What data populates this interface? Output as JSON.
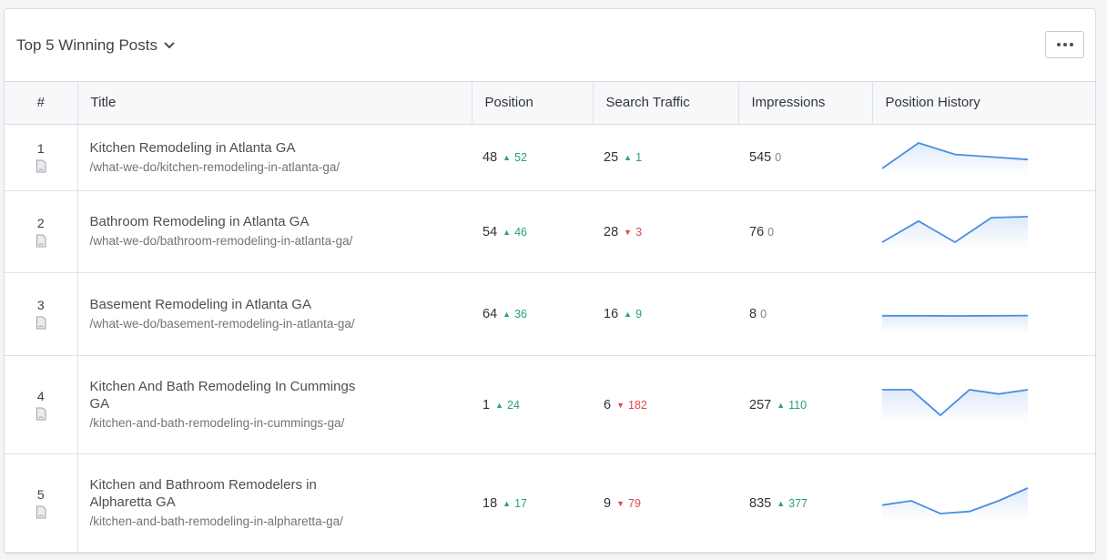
{
  "widget": {
    "title": "Top 5 Winning Posts"
  },
  "columns": {
    "num": "#",
    "title": "Title",
    "position": "Position",
    "traffic": "Search Traffic",
    "impressions": "Impressions",
    "history": "Position History"
  },
  "colors": {
    "accent": "#4a8ee0",
    "up": "#28a17a",
    "down": "#e0474c"
  },
  "rows": [
    {
      "rank": "1",
      "title": "Kitchen Remodeling in Atlanta GA",
      "url": "/what-we-do/kitchen-remodeling-in-atlanta-ga/",
      "position": "48",
      "position_delta": "52",
      "position_dir": "up",
      "traffic": "25",
      "traffic_delta": "1",
      "traffic_dir": "up",
      "impressions": "545",
      "impressions_delta": "0",
      "impressions_dir": "zero",
      "history": [
        28,
        48,
        39,
        37,
        35
      ]
    },
    {
      "rank": "2",
      "title": "Bathroom Remodeling in Atlanta GA",
      "url": "/what-we-do/bathroom-remodeling-in-atlanta-ga/",
      "position": "54",
      "position_delta": "46",
      "position_dir": "up",
      "traffic": "28",
      "traffic_delta": "3",
      "traffic_dir": "down",
      "impressions": "76",
      "impressions_delta": "0",
      "impressions_dir": "zero",
      "history": [
        40,
        52,
        40,
        54,
        54.5
      ]
    },
    {
      "rank": "3",
      "title": "Basement Remodeling in Atlanta GA",
      "url": "/what-we-do/basement-remodeling-in-atlanta-ga/",
      "position": "64",
      "position_delta": "36",
      "position_dir": "up",
      "traffic": "16",
      "traffic_delta": "9",
      "traffic_dir": "up",
      "impressions": "8",
      "impressions_delta": "0",
      "impressions_dir": "zero",
      "history": [
        64,
        64,
        63.8,
        64,
        64.3
      ]
    },
    {
      "rank": "4",
      "title": "Kitchen And Bath Remodeling In Cummings GA",
      "url": "/kitchen-and-bath-remodeling-in-cummings-ga/",
      "position": "1",
      "position_delta": "24",
      "position_dir": "up",
      "traffic": "6",
      "traffic_delta": "182",
      "traffic_dir": "down",
      "impressions": "257",
      "impressions_delta": "110",
      "impressions_dir": "up",
      "history": [
        25,
        25,
        1,
        25,
        21,
        25
      ]
    },
    {
      "rank": "5",
      "title": "Kitchen and Bathroom Remodelers in Alpharetta GA",
      "url": "/kitchen-and-bath-remodeling-in-alpharetta-ga/",
      "position": "18",
      "position_delta": "17",
      "position_dir": "up",
      "traffic": "9",
      "traffic_delta": "79",
      "traffic_dir": "down",
      "impressions": "835",
      "impressions_delta": "377",
      "impressions_dir": "up",
      "history": [
        12,
        14,
        8,
        9,
        14,
        20
      ]
    }
  ]
}
